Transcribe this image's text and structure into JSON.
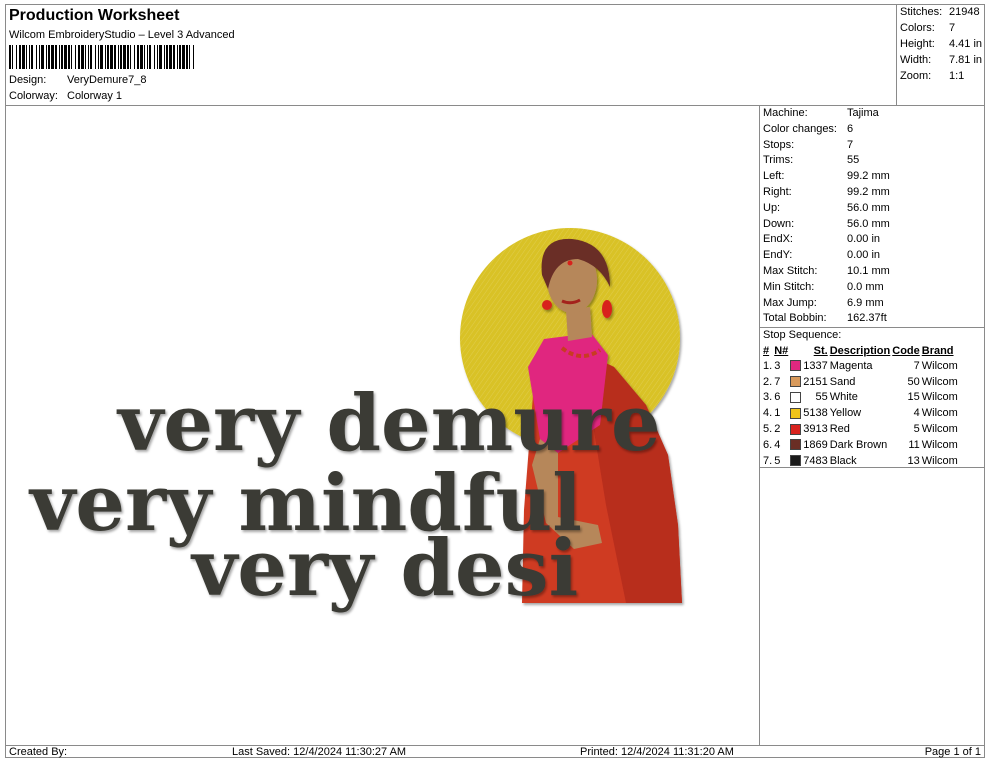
{
  "header": {
    "title": "Production Worksheet",
    "software": "Wilcom EmbroideryStudio – Level 3 Advanced",
    "design_label": "Design:",
    "design_value": "VeryDemure7_8",
    "colorway_label": "Colorway:",
    "colorway_value": "Colorway 1"
  },
  "summary": {
    "stitches_label": "Stitches:",
    "stitches": "21948",
    "colors_label": "Colors:",
    "colors": "7",
    "height_label": "Height:",
    "height": "4.41 in",
    "width_label": "Width:",
    "width": "7.81 in",
    "zoom_label": "Zoom:",
    "zoom": "1:1"
  },
  "machine_info": [
    {
      "label": "Machine:",
      "value": "Tajima"
    },
    {
      "label": "Color changes:",
      "value": "6"
    },
    {
      "label": "Stops:",
      "value": "7"
    },
    {
      "label": "Trims:",
      "value": "55"
    },
    {
      "label": "Left:",
      "value": "99.2 mm"
    },
    {
      "label": "Right:",
      "value": "99.2 mm"
    },
    {
      "label": "Up:",
      "value": "56.0 mm"
    },
    {
      "label": "Down:",
      "value": "56.0 mm"
    },
    {
      "label": "EndX:",
      "value": "0.00 in"
    },
    {
      "label": "EndY:",
      "value": "0.00 in"
    },
    {
      "label": "Max Stitch:",
      "value": "10.1 mm"
    },
    {
      "label": "Min Stitch:",
      "value": "0.0 mm"
    },
    {
      "label": "Max Jump:",
      "value": "6.9 mm"
    },
    {
      "label": "Total Bobbin:",
      "value": "162.37ft"
    }
  ],
  "stop_sequence": {
    "title": "Stop Sequence:",
    "headers": {
      "num": "#",
      "n": "N#",
      "st": "St.",
      "desc": "Description",
      "code": "Code",
      "brand": "Brand"
    },
    "rows": [
      {
        "num": "1.",
        "n": "3",
        "color": "#e0287f",
        "st": "1337",
        "desc": "Magenta",
        "code": "7",
        "brand": "Wilcom"
      },
      {
        "num": "2.",
        "n": "7",
        "color": "#d99a5b",
        "st": "2151",
        "desc": "Sand",
        "code": "50",
        "brand": "Wilcom"
      },
      {
        "num": "3.",
        "n": "6",
        "color": "#ffffff",
        "st": "55",
        "desc": "White",
        "code": "15",
        "brand": "Wilcom"
      },
      {
        "num": "4.",
        "n": "1",
        "color": "#f0c419",
        "st": "5138",
        "desc": "Yellow",
        "code": "4",
        "brand": "Wilcom"
      },
      {
        "num": "5.",
        "n": "2",
        "color": "#d8231e",
        "st": "3913",
        "desc": "Red",
        "code": "5",
        "brand": "Wilcom"
      },
      {
        "num": "6.",
        "n": "4",
        "color": "#6a2e25",
        "st": "1869",
        "desc": "Dark Brown",
        "code": "11",
        "brand": "Wilcom"
      },
      {
        "num": "7.",
        "n": "5",
        "color": "#1a1a1a",
        "st": "7483",
        "desc": "Black",
        "code": "13",
        "brand": "Wilcom"
      }
    ]
  },
  "design": {
    "line1": "very demure",
    "line2": "very mindful",
    "line3": "very desi",
    "circle_color": "#d9c228",
    "text_color": "#3a3a34"
  },
  "footer": {
    "created_by": "Created By:",
    "last_saved": "Last Saved: 12/4/2024 11:30:27 AM",
    "printed": "Printed: 12/4/2024 11:31:20 AM",
    "page": "Page 1 of 1"
  }
}
